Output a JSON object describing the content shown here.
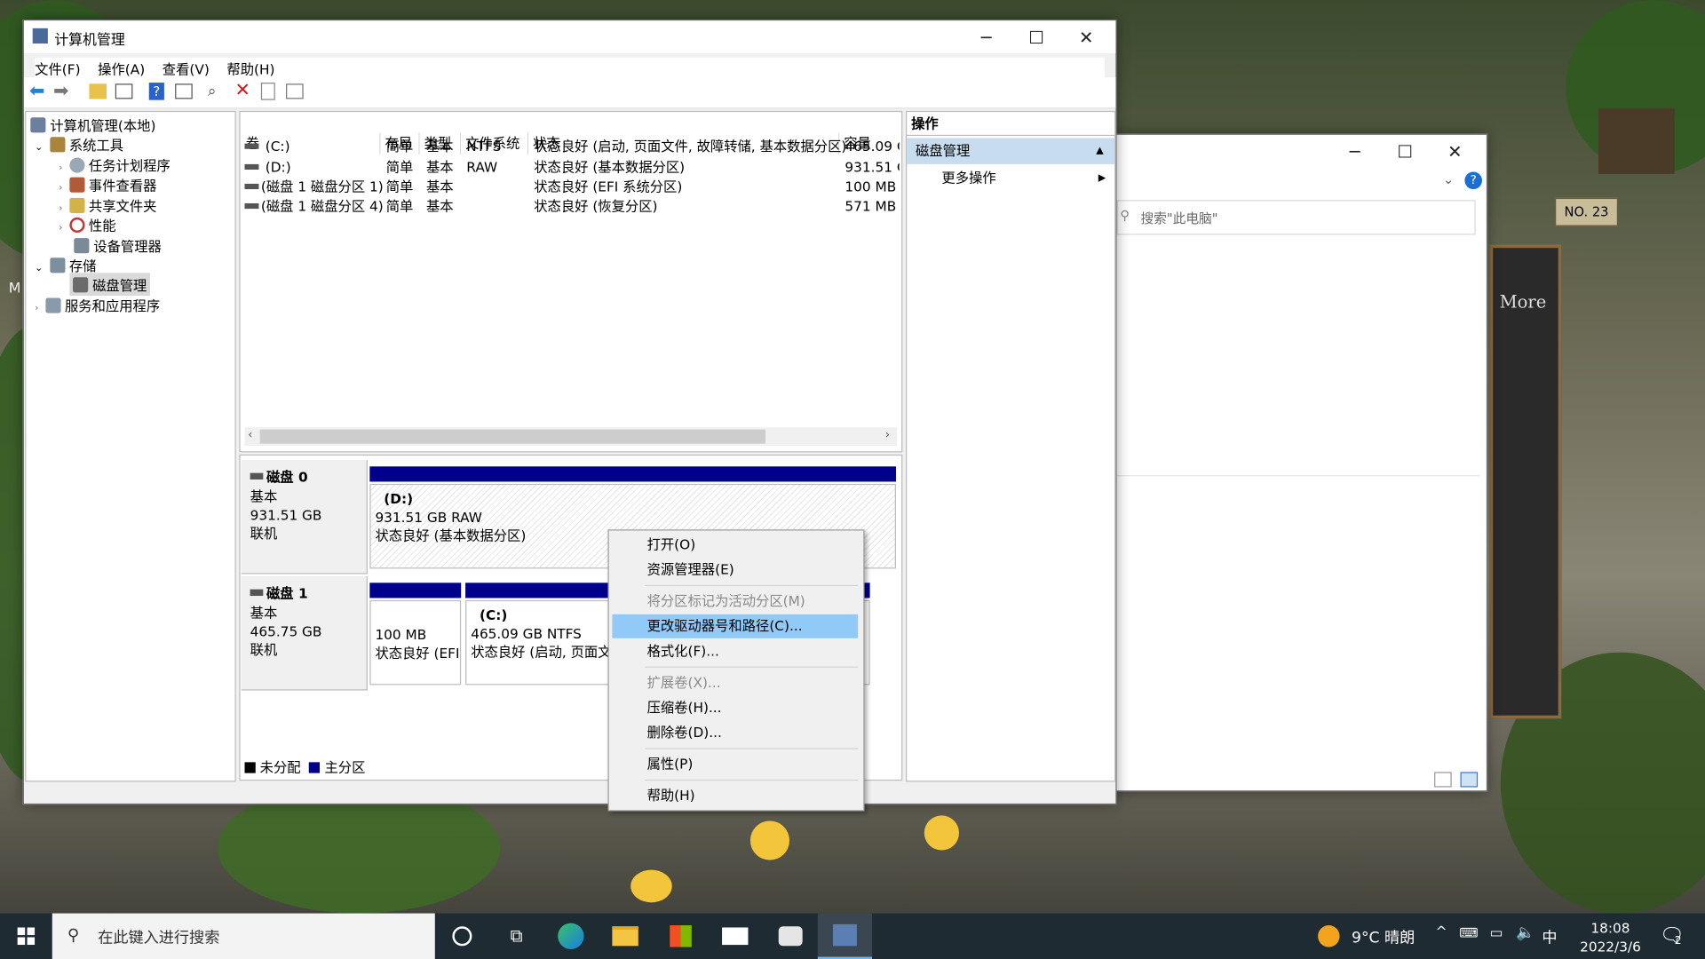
{
  "mmc": {
    "title": "计算机管理",
    "menus": [
      "文件(F)",
      "操作(A)",
      "查看(V)",
      "帮助(H)"
    ],
    "tree": {
      "root": "计算机管理(本地)",
      "system_tools": "系统工具",
      "task_scheduler": "任务计划程序",
      "event_viewer": "事件查看器",
      "shared_folders": "共享文件夹",
      "performance": "性能",
      "device_manager": "设备管理器",
      "storage": "存储",
      "disk_management": "磁盘管理",
      "services_apps": "服务和应用程序"
    },
    "columns": [
      "卷",
      "布局",
      "类型",
      "文件系统",
      "状态",
      "容量"
    ],
    "volumes": [
      {
        "name": "(C:)",
        "layout": "简单",
        "type": "基本",
        "fs": "NTFS",
        "status": "状态良好 (启动, 页面文件, 故障转储, 基本数据分区)",
        "capacity": "465.09 G"
      },
      {
        "name": "(D:)",
        "layout": "简单",
        "type": "基本",
        "fs": "RAW",
        "status": "状态良好 (基本数据分区)",
        "capacity": "931.51 G"
      },
      {
        "name": "(磁盘 1 磁盘分区 1)",
        "layout": "简单",
        "type": "基本",
        "fs": "",
        "status": "状态良好 (EFI 系统分区)",
        "capacity": "100 MB"
      },
      {
        "name": "(磁盘 1 磁盘分区 4)",
        "layout": "简单",
        "type": "基本",
        "fs": "",
        "status": "状态良好 (恢复分区)",
        "capacity": "571 MB"
      }
    ],
    "disk0": {
      "name": "磁盘 0",
      "type": "基本",
      "size": "931.51 GB",
      "state": "联机",
      "part": {
        "letter": "(D:)",
        "info": "931.51 GB RAW",
        "status": "状态良好 (基本数据分区)"
      }
    },
    "disk1": {
      "name": "磁盘 1",
      "type": "基本",
      "size": "465.75 GB",
      "state": "联机",
      "part1": {
        "info": "100 MB",
        "status": "状态良好 (EFI"
      },
      "part2": {
        "letter": "(C:)",
        "info": "465.09 GB NTFS",
        "status": "状态良好 (启动, 页面文"
      }
    },
    "legend": {
      "unallocated": "未分配",
      "primary": "主分区"
    },
    "actions": {
      "header": "操作",
      "section": "磁盘管理",
      "more": "更多操作"
    }
  },
  "context_menu": {
    "open": "打开(O)",
    "explorer": "资源管理器(E)",
    "mark_active": "将分区标记为活动分区(M)",
    "change_letter": "更改驱动器号和路径(C)...",
    "format": "格式化(F)...",
    "extend": "扩展卷(X)...",
    "shrink": "压缩卷(H)...",
    "delete": "删除卷(D)...",
    "properties": "属性(P)",
    "help": "帮助(H)"
  },
  "explorer": {
    "search_placeholder": "搜索\"此电脑\"",
    "help": "?"
  },
  "wallpaper_text": {
    "house_no": "NO. 23",
    "board": "More"
  },
  "desktop_fragment": "M",
  "taskbar": {
    "search_placeholder": "在此键入进行搜索",
    "weather": "9°C  晴朗",
    "ime": "中",
    "time": "18:08",
    "date": "2022/3/6",
    "notification_count": "2"
  },
  "colors": {
    "primary_partition": "#00008b",
    "menu_highlight": "#91c9f7",
    "taskbar": "#1f2b33"
  }
}
